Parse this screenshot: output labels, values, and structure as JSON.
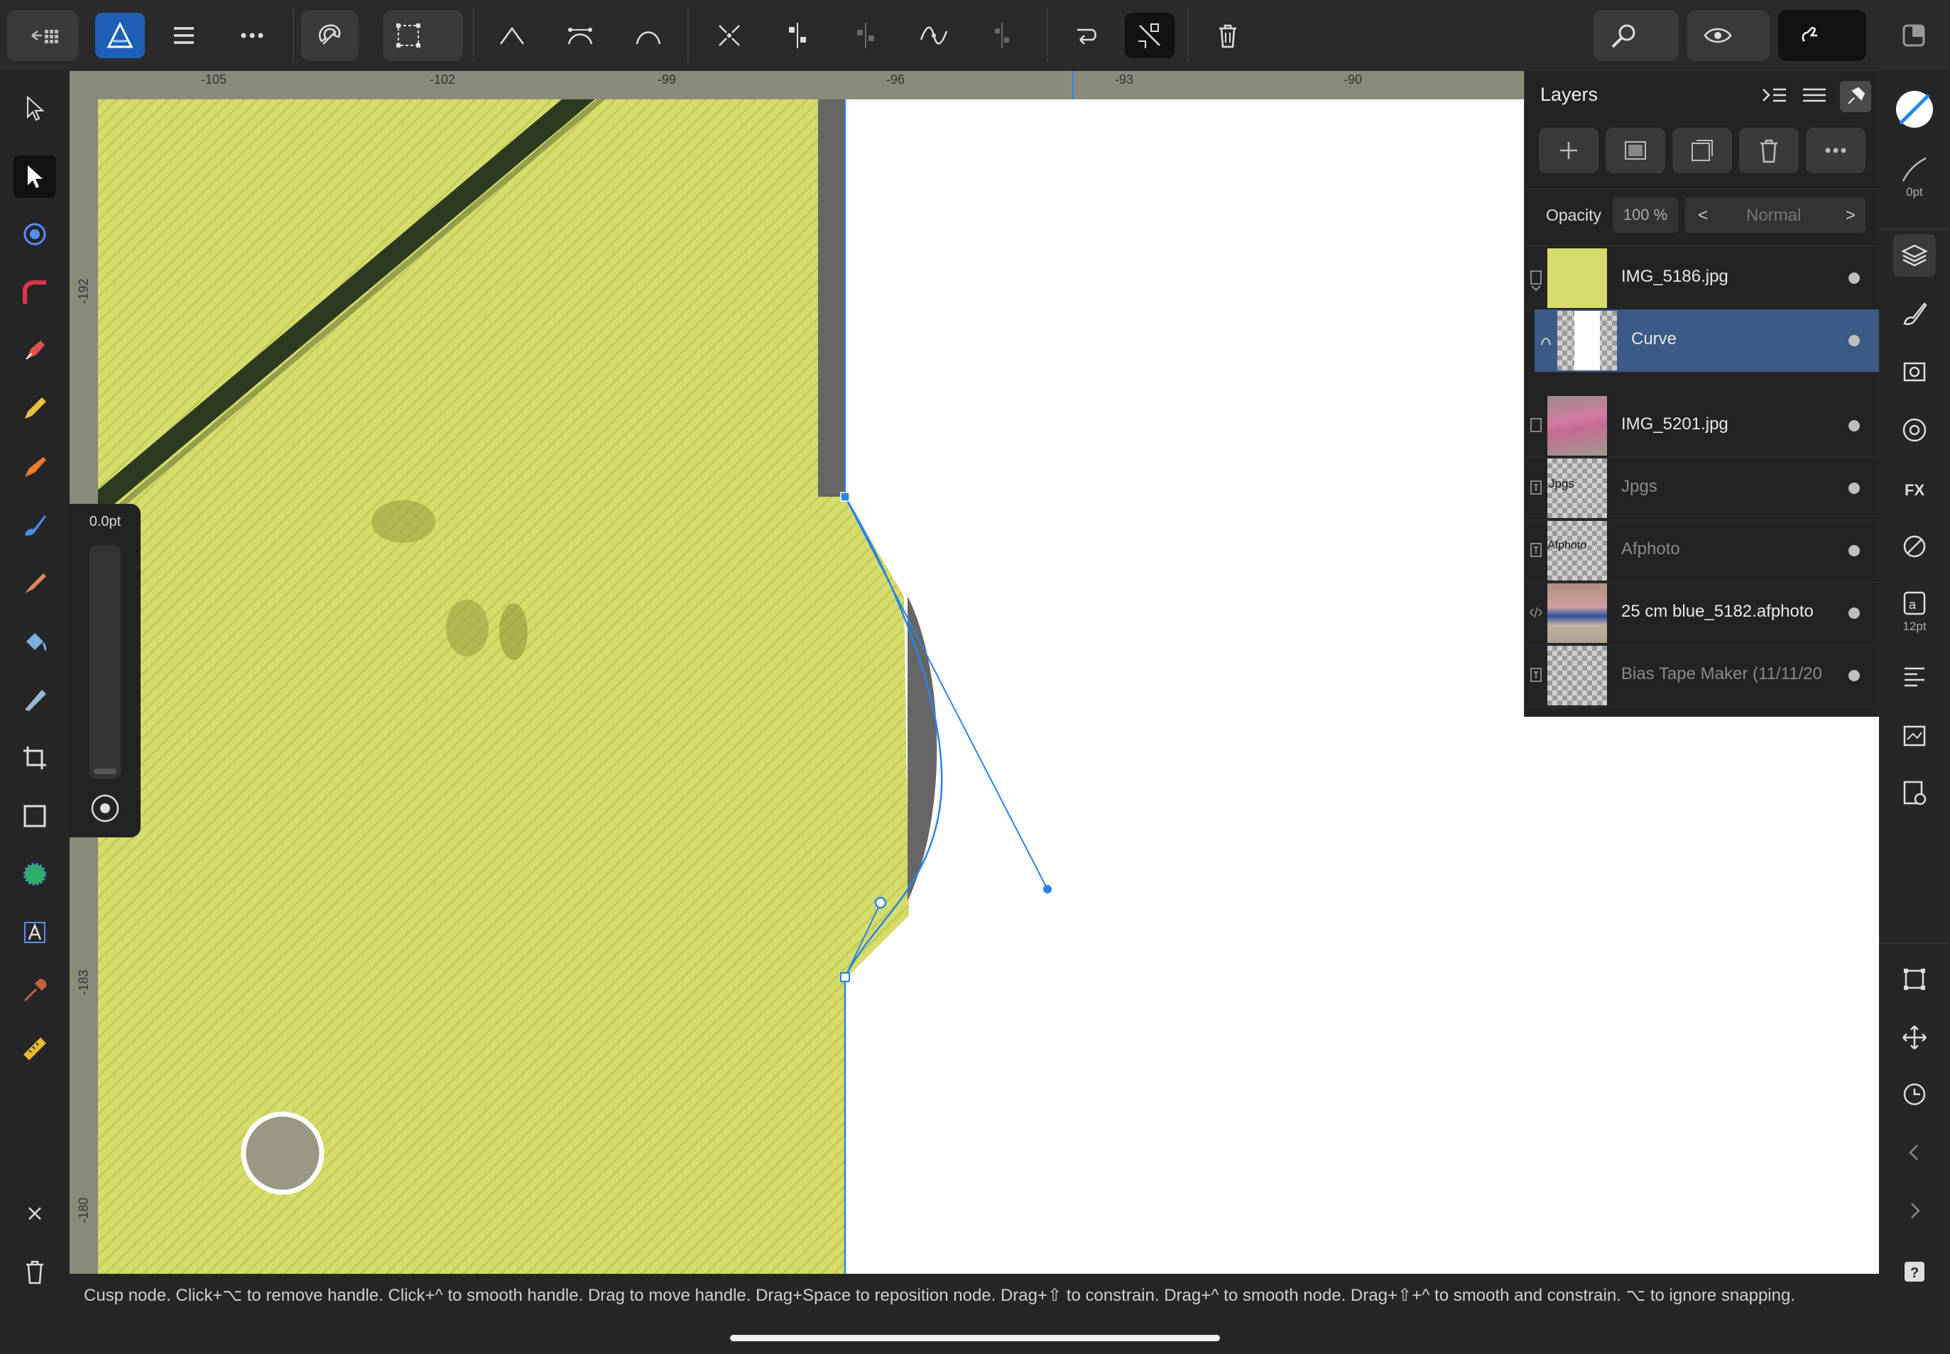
{
  "top_toolbar": {
    "items": [
      "back-to-gallery",
      "persona",
      "menu",
      "more",
      "snapping",
      "transform",
      "corner-tool",
      "smooth",
      "smart",
      "symmetric",
      "break-curve",
      "join-curves",
      "align-nodes",
      "make-sharp",
      "distribute",
      "reverse",
      "selection-mode",
      "delete"
    ]
  },
  "rulers": {
    "unit": "pt",
    "h_ticks": [
      "-105",
      "-102",
      "-99",
      "-96",
      "-93",
      "-90"
    ],
    "v_ticks": [
      "-192",
      "-183",
      "-180"
    ]
  },
  "pressure_panel": {
    "value": "0.0pt"
  },
  "layers_panel": {
    "title": "Layers",
    "opacity_label": "Opacity",
    "opacity_value": "100 %",
    "blend_mode": "Normal",
    "prev": "<",
    "next": ">",
    "layers": [
      {
        "name": "IMG_5186.jpg",
        "selected": false,
        "dim": false
      },
      {
        "name": "Curve",
        "selected": true,
        "dim": false
      },
      {
        "name": "IMG_5201.jpg",
        "selected": false,
        "dim": false
      },
      {
        "name": "Jpgs",
        "selected": false,
        "dim": true
      },
      {
        "name": "Afphoto",
        "selected": false,
        "dim": true
      },
      {
        "name": "25 cm blue_5182.afphoto",
        "selected": false,
        "dim": false
      },
      {
        "name": "Bias Tape Maker (11/11/20",
        "selected": false,
        "dim": true
      }
    ],
    "thumb_labels": {
      "jpgs": "Jpgs",
      "afphoto": "Afphoto"
    }
  },
  "right_studio": {
    "stroke_width": "0pt",
    "text_size": "12pt"
  },
  "status": {
    "text": "Cusp node. Click+⌥ to remove handle. Click+^ to smooth handle. Drag to move handle. Drag+Space to reposition node. Drag+⇧ to constrain. Drag+^ to smooth node. Drag+⇧+^ to smooth and constrain. ⌥ to ignore snapping."
  },
  "colors": {
    "accent": "#2f7fe0",
    "selection": "#3b5a85",
    "fabric": "#d6dc6a",
    "path": "#2a84e6"
  }
}
